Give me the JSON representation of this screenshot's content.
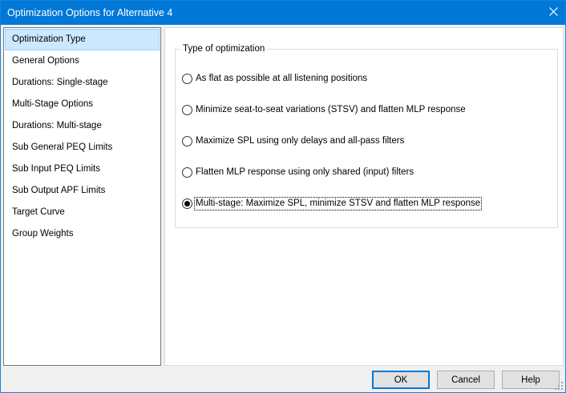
{
  "window": {
    "title": "Optimization Options for Alternative 4",
    "close_icon": "close-icon",
    "accent_color": "#0078d7"
  },
  "sidebar": {
    "items": [
      {
        "label": "Optimization Type",
        "selected": true
      },
      {
        "label": "General Options",
        "selected": false
      },
      {
        "label": "Durations: Single-stage",
        "selected": false
      },
      {
        "label": "Multi-Stage Options",
        "selected": false
      },
      {
        "label": "Durations: Multi-stage",
        "selected": false
      },
      {
        "label": "Sub General PEQ Limits",
        "selected": false
      },
      {
        "label": "Sub Input PEQ Limits",
        "selected": false
      },
      {
        "label": "Sub Output APF Limits",
        "selected": false
      },
      {
        "label": "Target Curve",
        "selected": false
      },
      {
        "label": "Group Weights",
        "selected": false
      }
    ]
  },
  "main": {
    "group_title": "Type of optimization",
    "options": [
      {
        "label": "As flat as possible at all listening positions",
        "checked": false
      },
      {
        "label": "Minimize seat-to-seat variations (STSV) and flatten MLP response",
        "checked": false
      },
      {
        "label": "Maximize SPL using only delays and all-pass filters",
        "checked": false
      },
      {
        "label": "Flatten MLP response using only shared (input) filters",
        "checked": false
      },
      {
        "label": "Multi-stage: Maximize SPL, minimize STSV and flatten MLP response",
        "checked": true
      }
    ]
  },
  "footer": {
    "ok_label": "OK",
    "cancel_label": "Cancel",
    "help_label": "Help"
  }
}
